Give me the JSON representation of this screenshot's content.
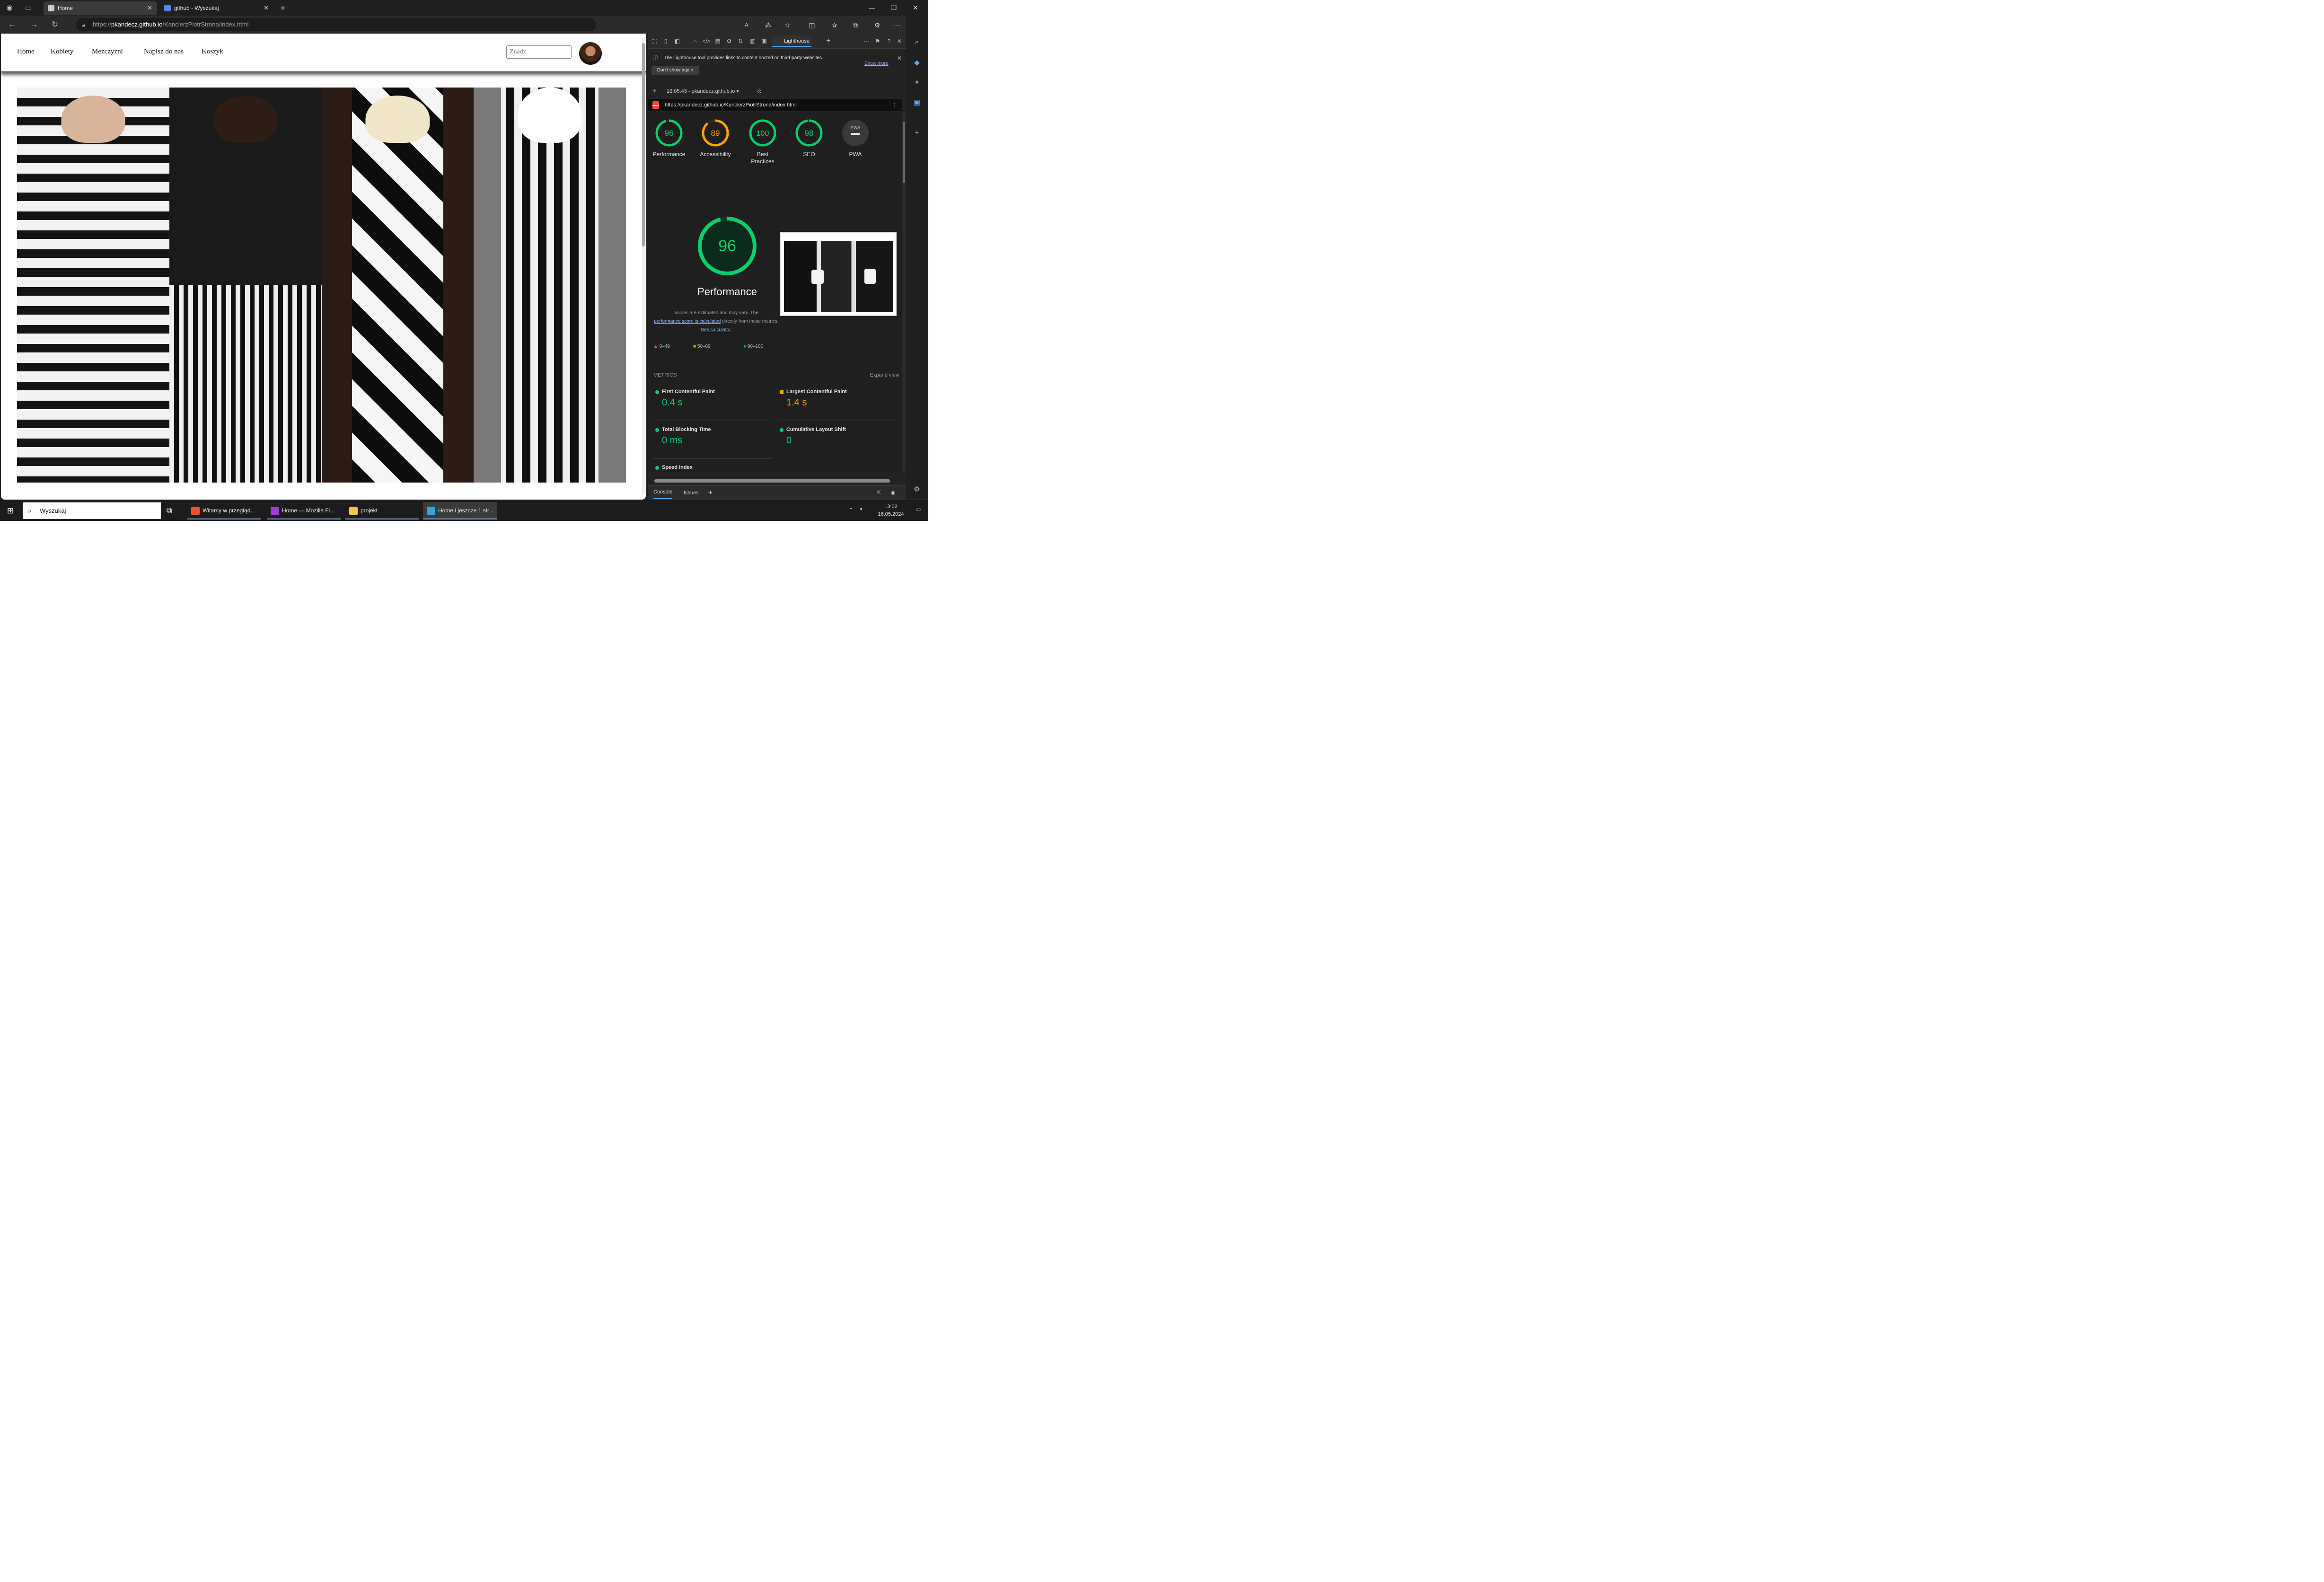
{
  "browser": {
    "tabs": [
      {
        "title": "Home",
        "favicon_color": "#cccccc"
      },
      {
        "title": "github - Wyszukaj",
        "favicon_color": "#4f8cff"
      }
    ],
    "url_scheme": "https://",
    "url_host": "pkandecz.github.io",
    "url_path": "/KanclerzPiotrStrona/index.html",
    "window_controls": [
      "—",
      "❐",
      "✕"
    ],
    "new_tab_icon": "+"
  },
  "site": {
    "nav": [
      "Home",
      "Kobiety",
      "Mezczyzni",
      "Napisz do nas",
      "Koszyk"
    ],
    "search_placeholder": "Znadz"
  },
  "devtools": {
    "panel_tab": "Lighthouse",
    "info_text": "The Lighthouse tool provides links to content hosted on third-party websites.",
    "show_more": "Show more",
    "dont_show": "Don't show again",
    "report_time": "13:05:43 - pkandecz.github.io ▾",
    "report_url": "https://pkandecz.github.io/KanclerzPiotrStrona/index.html",
    "scores": [
      {
        "label": "Performance",
        "value": "96",
        "color": "#0cce6b",
        "fraction": 0.96
      },
      {
        "label": "Accessibility",
        "value": "89",
        "color": "#ffa400",
        "fraction": 0.89
      },
      {
        "label": "Best Practices",
        "value": "100",
        "color": "#0cce6b",
        "fraction": 1.0
      },
      {
        "label": "SEO",
        "value": "98",
        "color": "#0cce6b",
        "fraction": 0.98
      },
      {
        "label": "PWA",
        "value": "PWA",
        "color": "#9e9e9e",
        "fraction": 0
      }
    ],
    "big_score": "96",
    "big_title": "Performance",
    "note_line1": "Values are estimated and may vary. The",
    "note_link1": "performance score is calculated",
    "note_line2": "directly from these metrics.",
    "note_link2": "See calculator.",
    "legend": [
      "0–49",
      "50–89",
      "90–100"
    ],
    "metrics_header": "METRICS",
    "expand_view": "Expand view",
    "metrics": [
      {
        "name": "First Contentful Paint",
        "value": "0.4 s",
        "color": "#0cce6b"
      },
      {
        "name": "Largest Contentful Paint",
        "value": "1.4 s",
        "color": "#ffa400"
      },
      {
        "name": "Total Blocking Time",
        "value": "0 ms",
        "color": "#0cce6b"
      },
      {
        "name": "Cumulative Layout Shift",
        "value": "0",
        "color": "#0cce6b"
      },
      {
        "name": "Speed Index",
        "value": "",
        "color": "#0cce6b"
      }
    ],
    "drawer_tabs": [
      "Console",
      "Issues"
    ]
  },
  "taskbar": {
    "search_placeholder": "Wyszukaj",
    "apps": [
      {
        "label": "Witamy w przegląd...",
        "color": "#e8542b"
      },
      {
        "label": "Home — Mozilla Fi...",
        "color": "#a53bd8"
      },
      {
        "label": "projekt",
        "color": "#f2c744"
      },
      {
        "label": "Home i jeszcze 1 str...",
        "color": "#2ea6e0"
      }
    ],
    "time": "13:02",
    "date": "16.05.2024"
  }
}
